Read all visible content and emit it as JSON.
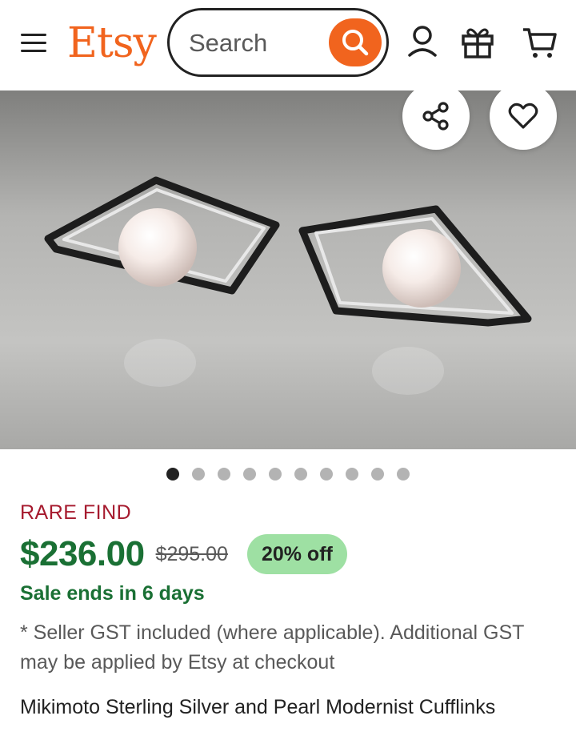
{
  "header": {
    "logo": "Etsy",
    "search_placeholder": "Search",
    "icons": [
      "menu-icon",
      "search-icon",
      "account-icon",
      "gift-icon",
      "cart-icon"
    ]
  },
  "gallery": {
    "image_count": 10,
    "active_index": 0,
    "actions": [
      "share-icon",
      "heart-icon"
    ]
  },
  "listing": {
    "tag": "RARE FIND",
    "price": "$236.00",
    "original_price": "$295.00",
    "discount": "20% off",
    "sale_text": "Sale ends in 6 days",
    "gst_note": "* Seller GST included (where applicable). Additional GST may be applied by Etsy at checkout",
    "title": "Mikimoto Sterling Silver and Pearl Modernist Cufflinks"
  },
  "colors": {
    "brand": "#F1641E",
    "price_green": "#1A7034",
    "badge_green": "#9EE0A3",
    "rare_red": "#A61A2E"
  }
}
